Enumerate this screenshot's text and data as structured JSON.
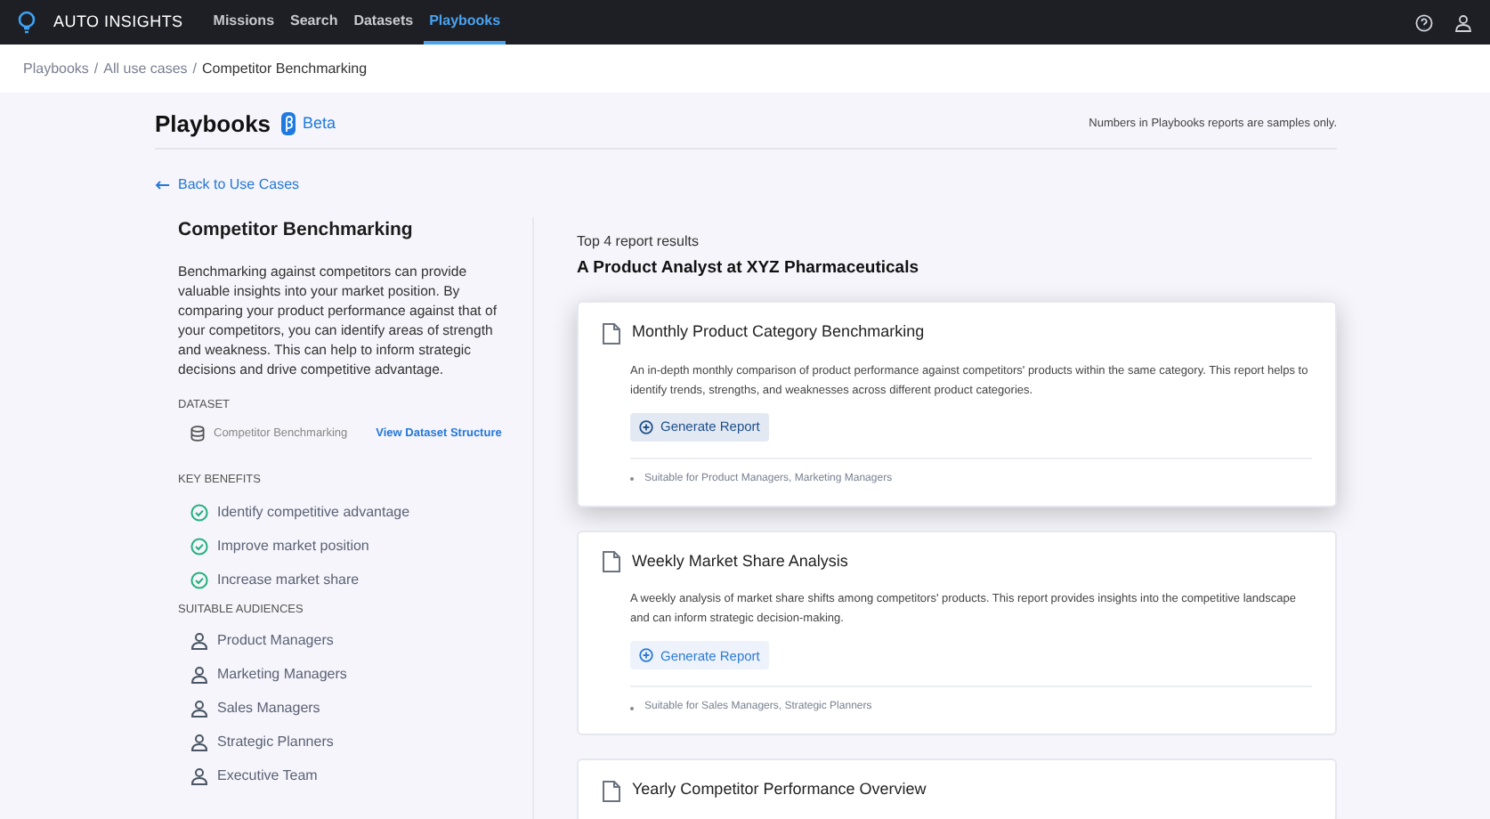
{
  "nav": {
    "brand": "AUTO INSIGHTS",
    "items": [
      {
        "label": "Missions",
        "selected": false
      },
      {
        "label": "Search",
        "selected": false
      },
      {
        "label": "Datasets",
        "selected": false
      },
      {
        "label": "Playbooks",
        "selected": true
      }
    ]
  },
  "breadcrumb": {
    "links": [
      "Playbooks",
      "All use cases"
    ],
    "separators": [
      "/",
      "/"
    ],
    "current": "Competitor Benchmarking"
  },
  "header": {
    "title": "Playbooks",
    "badge": "Beta",
    "note": "Numbers in Playbooks reports are samples only."
  },
  "back_link": "Back to Use Cases",
  "use_case": {
    "title": "Competitor Benchmarking",
    "description": "Benchmarking against competitors can provide valuable insights into your market position. By comparing your product performance against that of your competitors, you can identify areas of strength and weakness. This can help to inform strategic decisions and drive competitive advantage.",
    "dataset_heading": "DATASET",
    "dataset_name": "Competitor Benchmarking",
    "dataset_link": "View Dataset Structure",
    "benefits_heading": "KEY BENEFITS",
    "benefits": [
      "Identify competitive advantage",
      "Improve market position",
      "Increase market share"
    ],
    "audiences_heading": "SUITABLE AUDIENCES",
    "audiences": [
      "Product Managers",
      "Marketing Managers",
      "Sales Managers",
      "Strategic Planners",
      "Executive Team"
    ]
  },
  "results": {
    "count_label": "Top 4 report results",
    "persona": "A Product Analyst at XYZ Pharmaceuticals",
    "reports": [
      {
        "title": "Monthly Product Category Benchmarking",
        "highlighted": true,
        "description": "An in-depth monthly comparison of product performance against competitors' products within the same category. This report helps to identify trends, strengths, and weaknesses across different product categories.",
        "button": "Generate Report",
        "audience": "Suitable for Product Managers, Marketing Managers"
      },
      {
        "title": "Weekly Market Share Analysis",
        "highlighted": false,
        "description": "A weekly analysis of market share shifts among competitors' products. This report provides insights into the competitive landscape and can inform strategic decision-making.",
        "button": "Generate Report",
        "audience": "Suitable for Sales Managers, Strategic Planners"
      },
      {
        "title": "Yearly Competitor Performance Overview",
        "highlighted": false
      }
    ]
  }
}
